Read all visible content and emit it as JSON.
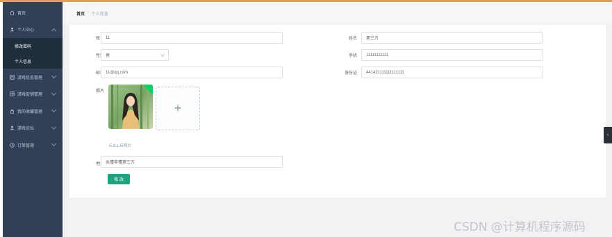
{
  "sidebar": {
    "items": [
      {
        "label": "首页",
        "icon": "home-icon"
      },
      {
        "label": "个人中心",
        "icon": "user-icon",
        "expanded": true,
        "children": [
          {
            "label": "修改密码"
          },
          {
            "label": "个人信息",
            "active": true
          }
        ]
      },
      {
        "label": "游戏信息管理",
        "icon": "grid-icon"
      },
      {
        "label": "游戏促销管理",
        "icon": "grid-icon"
      },
      {
        "label": "我的收藏管理",
        "icon": "lock-icon"
      },
      {
        "label": "游戏论坛",
        "icon": "user-icon"
      },
      {
        "label": "订单管理",
        "icon": "clock-icon"
      }
    ]
  },
  "breadcrumb": {
    "home": "首页",
    "separator": "/",
    "current": "个人信息"
  },
  "form": {
    "account_label": "账号",
    "account_value": "11",
    "name_label": "姓名",
    "name_value": "第三方",
    "gender_label": "性别",
    "gender_value": "男",
    "phone_label": "手机",
    "phone_value": "11111111111",
    "email_label": "邮箱",
    "email_value": "11@qq.com",
    "idcard_label": "身份证",
    "idcard_value": "441421111111111111",
    "photo_label": "照片",
    "upload_symbol": "+",
    "upload_hint": "点击上传照片",
    "address_label": "地址",
    "address_value": "似懂非懂第三方",
    "submit_label": "修 改"
  },
  "toggle_symbol": "‹",
  "watermark": "CSDN @计算机程序源码",
  "colors": {
    "sidebar_bg": "#304156",
    "accent": "#1fa37f",
    "top_border": "#d9a35b"
  }
}
